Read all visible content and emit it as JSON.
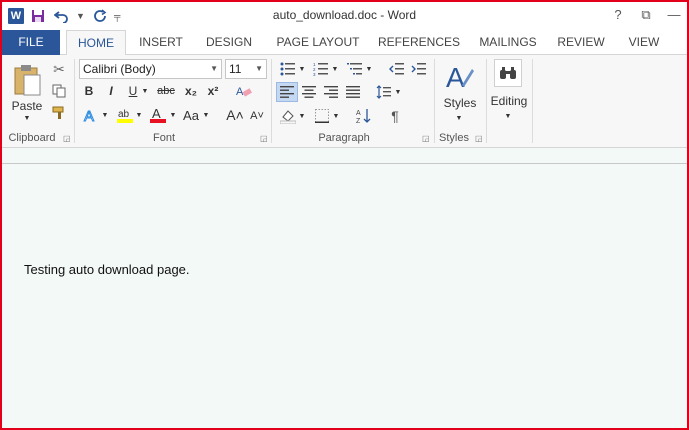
{
  "titlebar": {
    "app_icon": "W",
    "title": "auto_download.doc - Word",
    "qat": {
      "save": "save-icon",
      "undo": "undo-icon",
      "redo": "redo-icon"
    },
    "controls": {
      "help": "?",
      "ribbon_display": "⧉",
      "minimize": "—"
    }
  },
  "tabs": [
    "FILE",
    "HOME",
    "INSERT",
    "DESIGN",
    "PAGE LAYOUT",
    "REFERENCES",
    "MAILINGS",
    "REVIEW",
    "VIEW"
  ],
  "ribbon": {
    "clipboard": {
      "label": "Clipboard",
      "paste": "Paste"
    },
    "font": {
      "label": "Font",
      "font_name": "Calibri (Body)",
      "font_size": "11",
      "bold": "B",
      "italic": "I",
      "underline": "U",
      "strike": "abc",
      "subscript": "x₂",
      "superscript": "x²",
      "change_case": "Aa",
      "grow": "A˄",
      "shrink": "A˅"
    },
    "paragraph": {
      "label": "Paragraph",
      "pilcrow": "¶"
    },
    "styles": {
      "label": "Styles",
      "button": "Styles"
    },
    "editing": {
      "button": "Editing"
    }
  },
  "document": {
    "text": "Testing auto download page."
  },
  "colors": {
    "accent": "#2b579a",
    "frame_border": "#e3001b",
    "highlight_yellow": "#ffff00",
    "font_color_red": "#e81123",
    "doc_background": "#f3f9f6"
  }
}
